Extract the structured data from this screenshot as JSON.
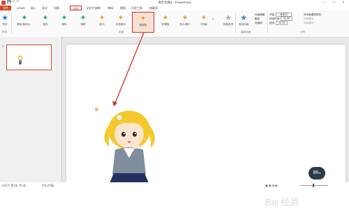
{
  "app": {
    "title": "演示文稿1 - PowerPoint"
  },
  "tabs": [
    {
      "label": "文件"
    },
    {
      "label": "HOME"
    },
    {
      "label": "插入"
    },
    {
      "label": "设计"
    },
    {
      "label": "切换"
    },
    {
      "label": "动画"
    },
    {
      "label": "幻灯片放映"
    },
    {
      "label": "审阅"
    },
    {
      "label": "视图"
    },
    {
      "label": "开发工具"
    },
    {
      "label": "加载项"
    }
  ],
  "ribbon": {
    "preview_label": "预览",
    "gallery": [
      {
        "label": "擦除/旋转出..."
      },
      {
        "label": "缩放"
      },
      {
        "label": "旋转"
      },
      {
        "label": "弹跳"
      },
      {
        "label": "脉冲"
      },
      {
        "label": "彩色脉冲"
      },
      {
        "label": "跷跷板"
      },
      {
        "label": "陀螺旋"
      },
      {
        "label": "放大/缩小"
      },
      {
        "label": "不饱和"
      }
    ],
    "effect_options": "效果选项",
    "add_animation": "添加动画",
    "animation_pane": "动画窗格",
    "trigger": "触发",
    "animation_painter": "动画刷",
    "start_label": "开始:",
    "start_value": "单击时",
    "duration_label": "持续时间:",
    "duration_value": "01.00",
    "delay_label": "延迟:",
    "delay_value": "00.00",
    "reorder": "对动画重新排序",
    "move_earlier": "向前移动",
    "move_later": "向后移动",
    "group_preview": "预览",
    "group_animation": "动画",
    "group_advanced": "高级动画",
    "group_timing": "计时"
  },
  "slides": [
    {
      "number": "1"
    }
  ],
  "canvas": {
    "anim_tag": "1"
  },
  "status": {
    "slide_info": "幻灯片 第1张, 共1张",
    "lang": "中文(中国)",
    "zoom": "86",
    "zoom_unit": "%"
  },
  "watermark": "Bai 经验"
}
